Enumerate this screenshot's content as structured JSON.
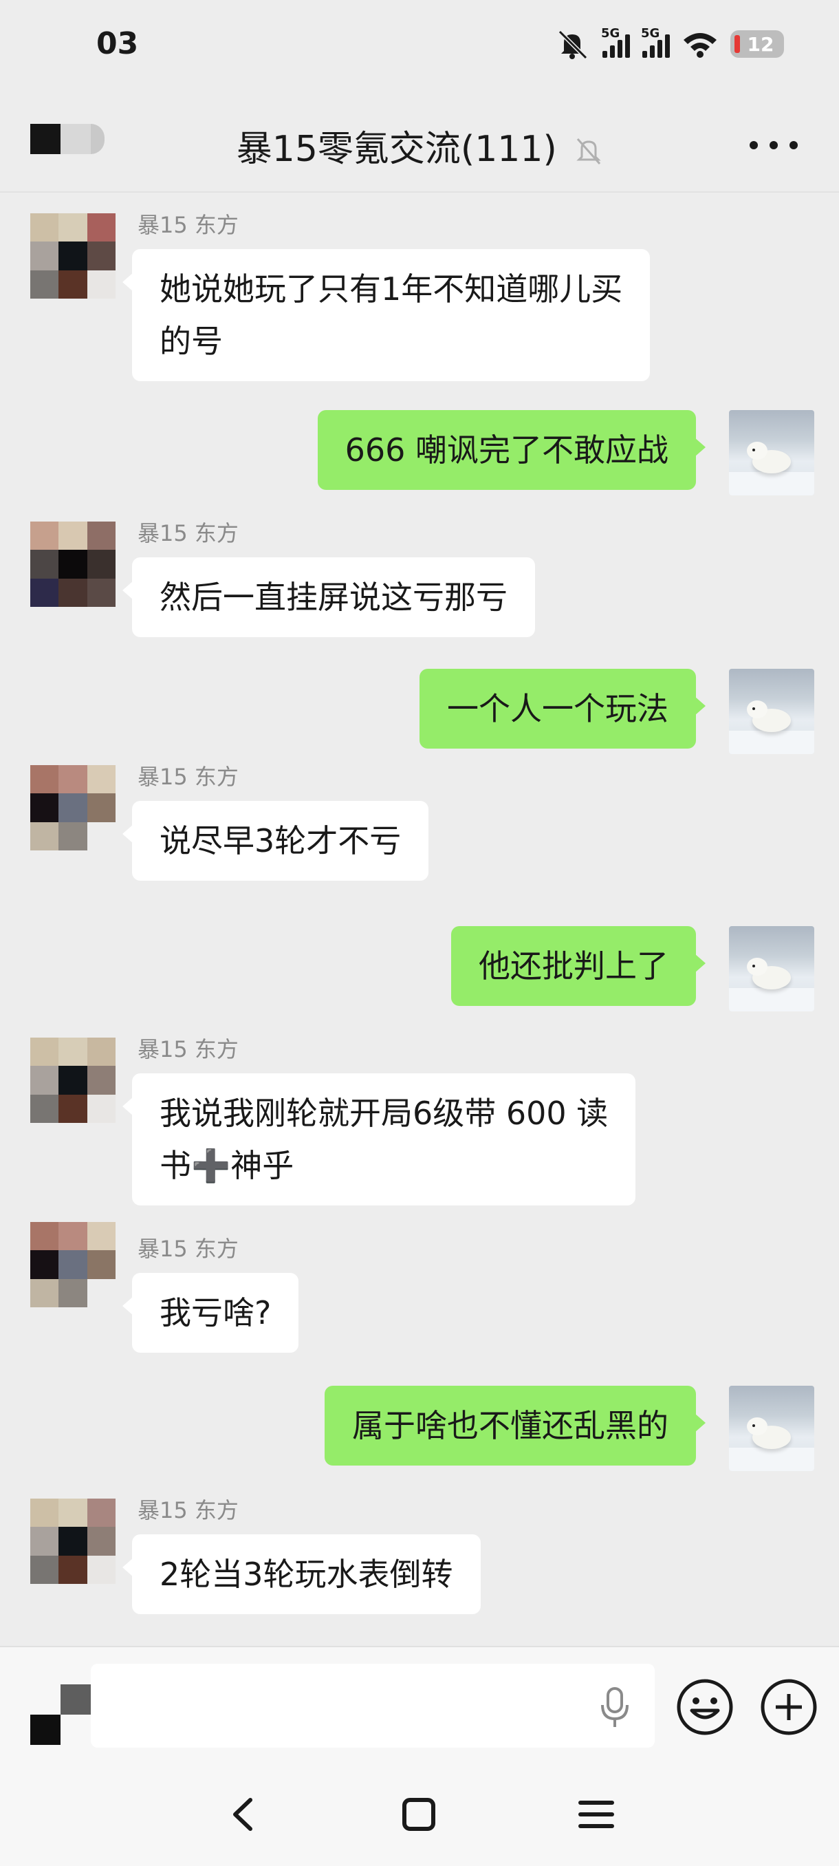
{
  "status_bar": {
    "time": "03",
    "network_1": "5G",
    "network_2": "5G",
    "battery": "12",
    "icons": [
      "mute-icon",
      "signal-icon",
      "signal-icon",
      "wifi-icon",
      "battery-icon"
    ]
  },
  "header": {
    "title": "暴15零氪交流(111)",
    "icons": [
      "back-icon",
      "mute-bell-icon",
      "more-icon"
    ]
  },
  "messages": [
    {
      "side": "left",
      "sender": "暴15 东方",
      "text": [
        "她说她玩了只有1年不知道哪儿买",
        "的号"
      ]
    },
    {
      "side": "right",
      "text": [
        "666 嘲讽完了不敢应战"
      ]
    },
    {
      "side": "left",
      "sender": "暴15 东方",
      "text": [
        "然后一直挂屏说这亏那亏"
      ]
    },
    {
      "side": "right",
      "text": [
        "一个人一个玩法"
      ]
    },
    {
      "side": "left",
      "sender": "暴15 东方",
      "text": [
        "说尽早3轮才不亏"
      ]
    },
    {
      "side": "right",
      "text": [
        "他还批判上了"
      ]
    },
    {
      "side": "left",
      "sender": "暴15 东方",
      "text": [
        "我说我刚轮就开局6级带 600 读",
        "书➕神乎"
      ]
    },
    {
      "side": "left",
      "sender": "暴15 东方",
      "text": [
        "我亏啥?"
      ]
    },
    {
      "side": "right",
      "text": [
        "属于啥也不懂还乱黑的"
      ]
    },
    {
      "side": "left",
      "sender": "暴15 东方",
      "text": [
        "2轮当3轮玩水表倒转"
      ]
    }
  ],
  "input_bar": {
    "placeholder": "",
    "icons": [
      "voice-keyboard-toggle-icon",
      "microphone-icon",
      "emoji-icon",
      "plus-icon"
    ]
  },
  "nav_bar": {
    "icons": [
      "back-nav-icon",
      "home-nav-icon",
      "menu-nav-icon"
    ]
  },
  "colors": {
    "background": "#ededed",
    "self_bubble": "#95ec69",
    "other_bubble": "#ffffff",
    "sender_name": "#8a8a8a"
  }
}
